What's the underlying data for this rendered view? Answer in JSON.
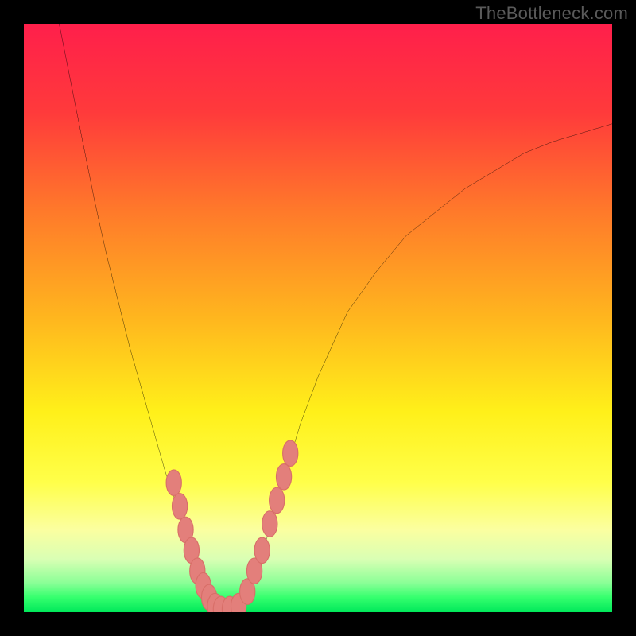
{
  "watermark": "TheBottleneck.com",
  "colors": {
    "frame": "#000000",
    "curve": "#000000",
    "marker_fill": "#e37f7b",
    "marker_stroke": "#d86e68"
  },
  "chart_data": {
    "type": "line",
    "title": "",
    "xlabel": "",
    "ylabel": "",
    "xlim": [
      0,
      100
    ],
    "ylim": [
      0,
      100
    ],
    "gradient_stops": [
      {
        "offset": 0.0,
        "color": "#ff1f4b"
      },
      {
        "offset": 0.15,
        "color": "#ff3a3b"
      },
      {
        "offset": 0.32,
        "color": "#ff7a2a"
      },
      {
        "offset": 0.5,
        "color": "#ffb61e"
      },
      {
        "offset": 0.66,
        "color": "#fff01a"
      },
      {
        "offset": 0.78,
        "color": "#ffff4a"
      },
      {
        "offset": 0.86,
        "color": "#fbffa0"
      },
      {
        "offset": 0.91,
        "color": "#d9ffb4"
      },
      {
        "offset": 0.95,
        "color": "#8bff97"
      },
      {
        "offset": 0.975,
        "color": "#35ff6e"
      },
      {
        "offset": 1.0,
        "color": "#00e85a"
      }
    ],
    "series": [
      {
        "name": "left-branch",
        "x": [
          6,
          8,
          10,
          12,
          14,
          16,
          18,
          20,
          22,
          24,
          26,
          27,
          28,
          29,
          30,
          31,
          32,
          33
        ],
        "y": [
          100,
          90,
          80,
          70,
          61,
          53,
          45,
          38,
          31,
          24,
          18,
          15,
          12,
          9,
          6,
          4,
          2,
          0
        ]
      },
      {
        "name": "right-branch",
        "x": [
          36,
          38,
          40,
          42,
          44,
          47,
          50,
          55,
          60,
          65,
          70,
          75,
          80,
          85,
          90,
          95,
          100
        ],
        "y": [
          0,
          3,
          8,
          15,
          22,
          32,
          40,
          51,
          58,
          64,
          68,
          72,
          75,
          78,
          80,
          81.5,
          83
        ]
      }
    ],
    "markers": {
      "name": "highlight-segments",
      "points": [
        {
          "x": 25.5,
          "y": 22
        },
        {
          "x": 26.5,
          "y": 18
        },
        {
          "x": 27.5,
          "y": 14
        },
        {
          "x": 28.5,
          "y": 10.5
        },
        {
          "x": 29.5,
          "y": 7
        },
        {
          "x": 30.5,
          "y": 4.5
        },
        {
          "x": 31.5,
          "y": 2.5
        },
        {
          "x": 32.5,
          "y": 1
        },
        {
          "x": 33.5,
          "y": 0.5
        },
        {
          "x": 35.0,
          "y": 0.5
        },
        {
          "x": 36.5,
          "y": 1
        },
        {
          "x": 38.0,
          "y": 3.5
        },
        {
          "x": 39.2,
          "y": 7
        },
        {
          "x": 40.5,
          "y": 10.5
        },
        {
          "x": 41.8,
          "y": 15
        },
        {
          "x": 43.0,
          "y": 19
        },
        {
          "x": 44.2,
          "y": 23
        },
        {
          "x": 45.3,
          "y": 27
        }
      ],
      "rx": 1.3,
      "ry": 2.2
    }
  }
}
